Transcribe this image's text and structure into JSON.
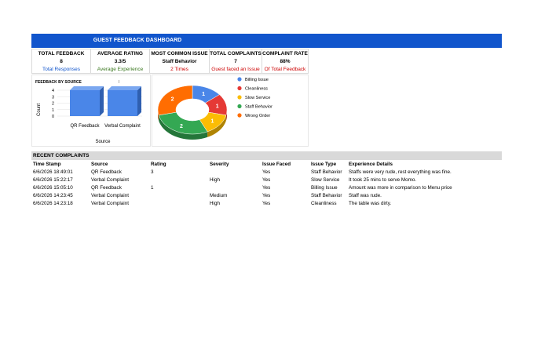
{
  "header": {
    "title": "GUEST FEEDBACK DASHBOARD",
    "bg_color": "#1155cc"
  },
  "kpis": [
    {
      "label": "TOTAL FEEDBACK",
      "value": "8",
      "sub": "Total Responses",
      "sub_color": "#1155cc"
    },
    {
      "label": "AVERAGE RATING",
      "value": "3.3/5",
      "sub": "Average Experience",
      "sub_color": "#38761d"
    },
    {
      "label": "MOST COMMON ISSUE",
      "value": "Staff Behavior",
      "sub": "2 Times",
      "sub_color": "#cc0000"
    },
    {
      "label": "TOTAL COMPLAINTS",
      "value": "7",
      "sub": "Guest faced an Issue",
      "sub_color": "#cc0000"
    },
    {
      "label": "COMPLAINT RATE",
      "value": "88%",
      "sub": "Of Total Feedback",
      "sub_color": "#cc0000"
    }
  ],
  "chart_data": [
    {
      "type": "bar",
      "title": "FEEDBACK BY SOURCE",
      "xlabel": "Source",
      "ylabel": "Count",
      "categories": [
        "QR Feedback",
        "Verbal Complaint"
      ],
      "values": [
        4,
        4
      ],
      "ylim": [
        0,
        4
      ],
      "yticks": [
        "0",
        "1",
        "2",
        "3",
        "4"
      ],
      "legend_mark": "I",
      "color": "#4a86e8"
    },
    {
      "type": "pie",
      "donut": true,
      "legend_position": "right",
      "slices": [
        {
          "name": "Billing Issue",
          "value": 1,
          "color": "#4a86e8"
        },
        {
          "name": "Cleanliness",
          "value": 1,
          "color": "#e53935"
        },
        {
          "name": "Slow Service",
          "value": 1,
          "color": "#fbbc04"
        },
        {
          "name": "Staff Behavior",
          "value": 2,
          "color": "#34a853"
        },
        {
          "name": "Wrong Order",
          "value": 2,
          "color": "#ff6d01"
        }
      ]
    }
  ],
  "complaints": {
    "title": "RECENT COMPLAINTS",
    "columns": [
      "Time Stamp",
      "Source",
      "Rating",
      "Severity",
      "Issue Faced",
      "Issue Type",
      "Experience Details"
    ],
    "rows": [
      [
        "6/6/2026 18:49:01",
        "QR Feedback",
        "3",
        "",
        "Yes",
        "Staff Behavior",
        "Staffs were very rude, rest everything was fine."
      ],
      [
        "6/6/2026 15:22:17",
        "Verbal Complaint",
        "",
        "High",
        "Yes",
        "Slow Service",
        "It took 25 mins to serve Momo."
      ],
      [
        "6/6/2026 15:05:10",
        "QR Feedback",
        "1",
        "",
        "Yes",
        "Billing Issue",
        "Amount was more in comparison to Menu price"
      ],
      [
        "6/6/2026 14:23:45",
        "Verbal Complaint",
        "",
        "Medium",
        "Yes",
        "Staff Behavior",
        "Staff was rude."
      ],
      [
        "6/6/2026 14:23:18",
        "Verbal Complaint",
        "",
        "High",
        "Yes",
        "Cleanliness",
        "The table was dirty."
      ]
    ]
  }
}
